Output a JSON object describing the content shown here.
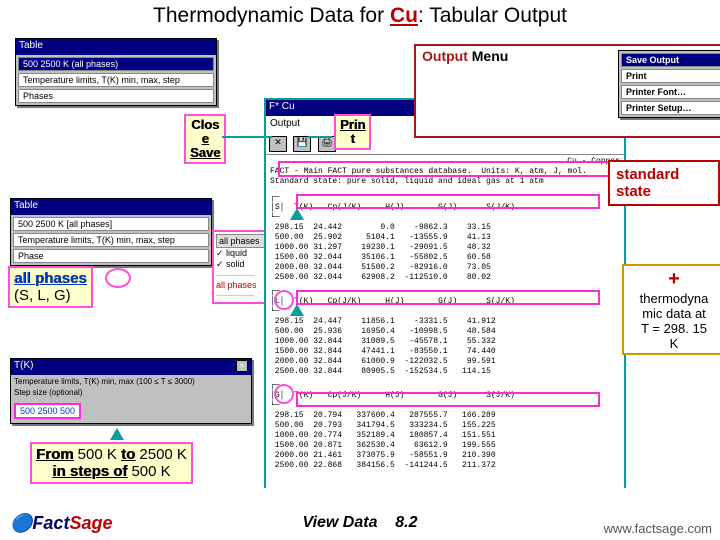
{
  "title_a": "Thermodynamic Data for ",
  "title_cu": "Cu",
  "title_b": ": Tabular Output",
  "output_menu": {
    "label_a": "Output",
    "label_b": " Menu"
  },
  "clos": "Clos",
  "e": "e",
  "save": "Save",
  "print": "Prin",
  "print2": "t",
  "standard_state": "standard state",
  "right_callout": {
    "plus": "+",
    "l1": "thermodyna",
    "l2": "mic data at",
    "l3": "T = 298. 15",
    "l4": "K"
  },
  "allphases": {
    "link": "all phases",
    "rest": "(S, L, G)"
  },
  "from": {
    "a": "From",
    "v1": " 500 K ",
    "b": "to",
    "v2": " 2500 K"
  },
  "steps": {
    "a": "in steps of",
    "b": " 500 K"
  },
  "footer": "www.factsage.com",
  "footer_mid_a": "View Data",
  "footer_mid_b": "8.2",
  "logo_a": "Fact",
  "logo_b": "Sage",
  "tableMenu": {
    "title": "Table",
    "r1": "500 2500 K (all phases)",
    "r2": "Temperature limits, T(K) min, max, step",
    "r3": "Phases"
  },
  "tableMenu2": {
    "title": "Table",
    "r1": "500 2500 K [all phases]",
    "r2": "Temperature limits, T(K) min, max, step",
    "r3": "Phase"
  },
  "phaseWin": {
    "sel": "all phases",
    "items": [
      "✓ liquid",
      "✓ solid",
      "──────",
      "all phases",
      "──────"
    ]
  },
  "rangeWin": {
    "title": "T(K)",
    "l1": "Temperature limits, T(K) min, max (100 ≤ T ≤ 3000)",
    "l2": "Step size (optional)",
    "val": "500 2500 500"
  },
  "bigWin": {
    "title": "F* Cu",
    "menu": "Output",
    "h1": "Cu - Copper",
    "h2": "FACT - Main FACT pure substances database.  Units: K, atm, J, mol.",
    "h3": "Standard state: pure solid, liquid and ideal gas at 1 atm"
  },
  "fileMenu": {
    "save": "Save Output",
    "print": "Print",
    "font": "Printer Font…",
    "setup": "Printer Setup…"
  },
  "tables": {
    "S": {
      "label": "S",
      "hdr": "  T(K)   Cp(J/K)     H(J)       G(J)      S(J/K)",
      "rows": [
        " 298.15  24.442        0.0    -9862.3    33.15",
        " 500.00  25.902     5104.1   -13555.9    41.13",
        " 1000.00 31.297    19230.1   -29091.5    48.32",
        " 1500.00 32.044    35106.1   -55802.5    60.58",
        " 2000.00 32.044    51500.2   -82916.0    73.05",
        " 2500.00 32.044    62908.2  -112510.0    80.02"
      ]
    },
    "L": {
      "label": "L",
      "hdr": "  T(K)   Cp(J/K)     H(J)       G(J)      S(J/K)",
      "rows": [
        " 298.15  24.447    11856.1    -3331.5    41.912",
        " 500.00  25.936    16950.4   -10998.5    48.584",
        " 1000.00 32.844    31089.5   -45578.1    55.332",
        " 1500.00 32.844    47441.1   -83550.1    74.440",
        " 2000.00 32.844    61000.9  -122032.5    99.591",
        " 2500.00 32.844    80905.5  -152534.5   114.15"
      ]
    },
    "G": {
      "label": "G",
      "hdr": "  T(K)   Cp(J/K)     H(J)       G(J)      S(J/K)",
      "rows": [
        " 298.15  20.794   337600.4   287555.7   166.289",
        " 500.00  20.793   341794.5   333234.5   155.225",
        " 1000.00 20.774   352189.4   180857.4   151.551",
        " 1500.00 20.871   362530.4    63612.9   199.555",
        " 2000.00 21.461   373075.9   -58551.9   210.390",
        " 2500.00 22.868   384156.5  -141244.5   211.372"
      ]
    }
  }
}
